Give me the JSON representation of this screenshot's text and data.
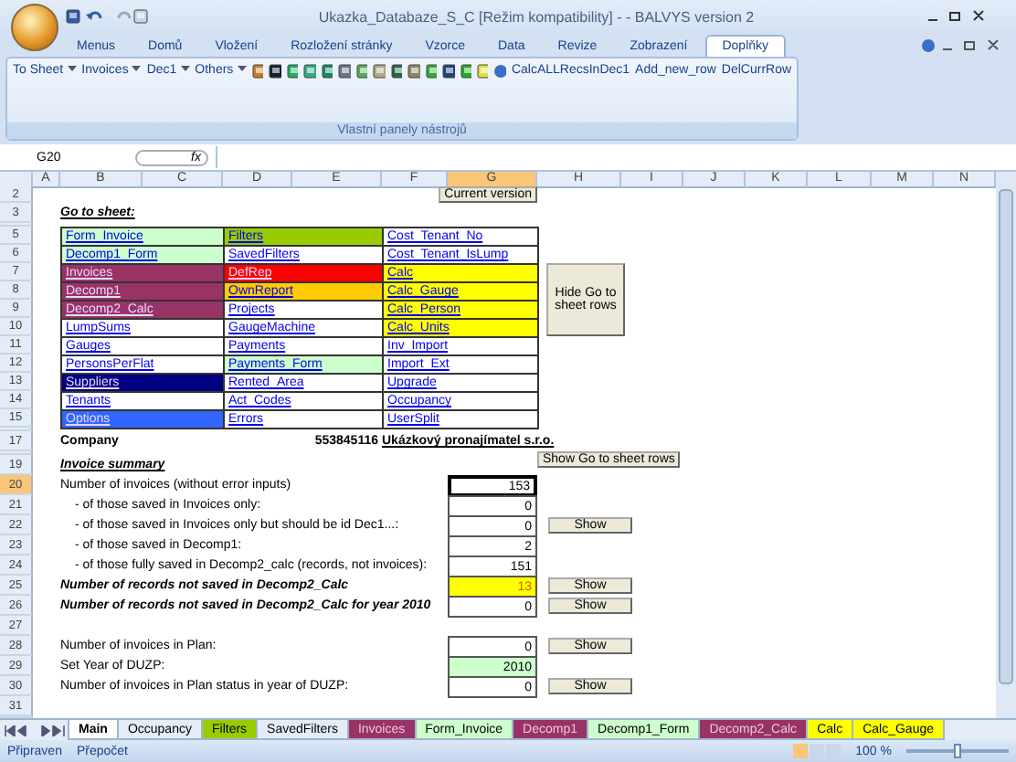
{
  "window": {
    "title": "Ukazka_Databaze_S_C [Režim kompatibility] - - BALVYS version 2"
  },
  "ribbon_tabs": [
    {
      "label": "Menus",
      "selected": false
    },
    {
      "label": "Domů",
      "selected": false
    },
    {
      "label": "Vložení",
      "selected": false
    },
    {
      "label": "Rozložení stránky",
      "selected": false
    },
    {
      "label": "Vzorce",
      "selected": false
    },
    {
      "label": "Data",
      "selected": false
    },
    {
      "label": "Revize",
      "selected": false
    },
    {
      "label": "Zobrazení",
      "selected": false
    },
    {
      "label": "Doplňky",
      "selected": true
    }
  ],
  "toolbar": {
    "menus": [
      "To Sheet",
      "Invoices",
      "Dec1",
      "Others"
    ],
    "commands": [
      "CalcALLRecsInDec1",
      "Add_new_row",
      "DelCurrRow"
    ],
    "group_label": "Vlastní panely nástrojů"
  },
  "formula_bar": {
    "name_box": "G20",
    "fx": "fx"
  },
  "columns": [
    {
      "label": "A",
      "selected": false
    },
    {
      "label": "B",
      "selected": false
    },
    {
      "label": "C",
      "selected": false
    },
    {
      "label": "D",
      "selected": false
    },
    {
      "label": "E",
      "selected": false
    },
    {
      "label": "F",
      "selected": false
    },
    {
      "label": "G",
      "selected": true
    },
    {
      "label": "H",
      "selected": false
    },
    {
      "label": "I",
      "selected": false
    },
    {
      "label": "J",
      "selected": false
    },
    {
      "label": "K",
      "selected": false
    },
    {
      "label": "L",
      "selected": false
    },
    {
      "label": "M",
      "selected": false
    },
    {
      "label": "N",
      "selected": false
    }
  ],
  "rows": [
    {
      "num": "2",
      "kind": "version",
      "version_button": "Current version"
    },
    {
      "num": "3",
      "kind": "heading",
      "text": "Go to sheet:"
    },
    {
      "num": "5",
      "kind": "links",
      "links": [
        {
          "label": "Form_Invoice",
          "color": "#ccffcc"
        },
        {
          "label": "Filters",
          "color": "#99cc00"
        },
        {
          "label": "Cost_Tenant_No",
          "color": "#ffffff"
        }
      ]
    },
    {
      "num": "6",
      "kind": "links",
      "links": [
        {
          "label": "Decomp1_Form",
          "color": "#ccffcc"
        },
        {
          "label": "SavedFilters",
          "color": "#ffffff"
        },
        {
          "label": "Cost_Tenant_IsLump",
          "color": "#ffffff"
        }
      ]
    },
    {
      "num": "7",
      "kind": "links",
      "links": [
        {
          "label": "Invoices",
          "color": "#993366"
        },
        {
          "label": "DefRep",
          "color": "#ff0000"
        },
        {
          "label": "Calc",
          "color": "#ffff00"
        }
      ]
    },
    {
      "num": "8",
      "kind": "links",
      "links": [
        {
          "label": "Decomp1",
          "color": "#993366"
        },
        {
          "label": "OwnReport",
          "color": "#ffcc00"
        },
        {
          "label": "Calc_Gauge",
          "color": "#ffff00"
        }
      ]
    },
    {
      "num": "9",
      "kind": "links",
      "links": [
        {
          "label": "Decomp2_Calc",
          "color": "#993366"
        },
        {
          "label": "Projects",
          "color": "#ffffff"
        },
        {
          "label": "Calc_Person",
          "color": "#ffff00"
        }
      ]
    },
    {
      "num": "10",
      "kind": "links",
      "links": [
        {
          "label": "LumpSums",
          "color": "#ffffff"
        },
        {
          "label": "GaugeMachine",
          "color": "#ffffff"
        },
        {
          "label": "Calc_Units",
          "color": "#ffff00"
        }
      ]
    },
    {
      "num": "11",
      "kind": "links",
      "links": [
        {
          "label": "Gauges",
          "color": "#ffffff"
        },
        {
          "label": "Payments",
          "color": "#ffffff"
        },
        {
          "label": "Inv_Import",
          "color": "#ffffff"
        }
      ]
    },
    {
      "num": "12",
      "kind": "links",
      "links": [
        {
          "label": "PersonsPerFlat",
          "color": "#ffffff"
        },
        {
          "label": "Payments_Form",
          "color": "#ccffcc"
        },
        {
          "label": "Import_Ext",
          "color": "#ffffff"
        }
      ]
    },
    {
      "num": "13",
      "kind": "links",
      "links": [
        {
          "label": "Suppliers",
          "color": "#000080"
        },
        {
          "label": "Rented_Area",
          "color": "#ffffff"
        },
        {
          "label": "Upgrade",
          "color": "#ffffff"
        }
      ]
    },
    {
      "num": "14",
      "kind": "links",
      "links": [
        {
          "label": "Tenants",
          "color": "#ffffff"
        },
        {
          "label": "Act_Codes",
          "color": "#ffffff"
        },
        {
          "label": "Occupancy",
          "color": "#ffffff"
        }
      ]
    },
    {
      "num": "15",
      "kind": "links",
      "links": [
        {
          "label": "Options",
          "color": "#3366ff"
        },
        {
          "label": "Errors",
          "color": "#ffffff"
        },
        {
          "label": "UserSplit",
          "color": "#ffffff"
        }
      ]
    },
    {
      "num": "17",
      "kind": "company",
      "label": "Company",
      "id": "553845116",
      "name": "Ukázkový pronajímatel s.r.o."
    },
    {
      "num": "19",
      "kind": "subheading",
      "text": "Invoice summary",
      "button": "Show Go to sheet rows"
    },
    {
      "num": "20",
      "kind": "stat",
      "label": "Number of invoices (without error inputs)",
      "value": "153",
      "selected": true,
      "indented": false,
      "emphasis": false
    },
    {
      "num": "21",
      "kind": "stat",
      "label": "- of those saved in Invoices only:",
      "value": "0",
      "selected": false,
      "indented": true,
      "emphasis": false
    },
    {
      "num": "22",
      "kind": "stat",
      "label": "- of those saved in Invoices only but should be id Dec1...:",
      "value": "0",
      "selected": false,
      "indented": true,
      "emphasis": false,
      "button": "Show"
    },
    {
      "num": "23",
      "kind": "stat",
      "label": "- of those saved in Decomp1:",
      "value": "2",
      "selected": false,
      "indented": true,
      "emphasis": false
    },
    {
      "num": "24",
      "kind": "stat",
      "label": "- of those fully saved in Decomp2_calc (records, not invoices):",
      "value": "151",
      "selected": false,
      "indented": true,
      "emphasis": false
    },
    {
      "num": "25",
      "kind": "stat",
      "label": "Number of records not saved in Decomp2_Calc",
      "value": "13",
      "selected": false,
      "indented": false,
      "emphasis": true,
      "color": "#ffff00",
      "button": "Show"
    },
    {
      "num": "26",
      "kind": "stat",
      "label": "Number of records not saved in Decomp2_Calc for year 2010",
      "value": "0",
      "selected": false,
      "indented": false,
      "emphasis": true,
      "button": "Show"
    },
    {
      "num": "27",
      "kind": "blank"
    },
    {
      "num": "28",
      "kind": "stat",
      "label": "Number of invoices in Plan:",
      "value": "0",
      "selected": false,
      "indented": false,
      "emphasis": false,
      "button": "Show"
    },
    {
      "num": "29",
      "kind": "stat",
      "label": "Set Year of DUZP:",
      "value": "2010",
      "selected": false,
      "indented": false,
      "emphasis": false,
      "color": "#ccffcc"
    },
    {
      "num": "30",
      "kind": "stat",
      "label": "Number of invoices in Plan status in year of DUZP:",
      "value": "0",
      "selected": false,
      "indented": false,
      "emphasis": false,
      "button": "Show"
    },
    {
      "num": "31",
      "kind": "blank"
    }
  ],
  "hide_button": "Hide Go to sheet rows",
  "sheet_tabs": [
    {
      "label": "Main",
      "selected": true,
      "color": "#ffffff"
    },
    {
      "label": "Occupancy",
      "selected": false,
      "color": "#e4ecf7"
    },
    {
      "label": "Filters",
      "selected": false,
      "color": "#99cc00"
    },
    {
      "label": "SavedFilters",
      "selected": false,
      "color": "#e4ecf7"
    },
    {
      "label": "Invoices",
      "selected": false,
      "color": "#993366"
    },
    {
      "label": "Form_Invoice",
      "selected": false,
      "color": "#ccffcc"
    },
    {
      "label": "Decomp1",
      "selected": false,
      "color": "#993366"
    },
    {
      "label": "Decomp1_Form",
      "selected": false,
      "color": "#ccffcc"
    },
    {
      "label": "Decomp2_Calc",
      "selected": false,
      "color": "#993366"
    },
    {
      "label": "Calc",
      "selected": false,
      "color": "#ffff00"
    },
    {
      "label": "Calc_Gauge",
      "selected": false,
      "color": "#ffff00"
    }
  ],
  "status_bar": {
    "left": [
      "Připraven",
      "Přepočet"
    ],
    "zoom": {
      "reading": "100 %",
      "level": 0.5
    }
  }
}
